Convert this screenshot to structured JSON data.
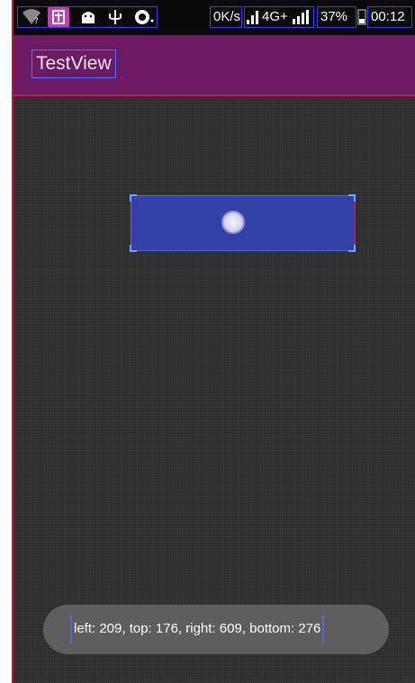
{
  "status_bar": {
    "icons": [
      "wifi-question-icon",
      "usb-debug-icon",
      "android-icon",
      "usb-icon",
      "chat-icon"
    ],
    "network_speed": "0K/s",
    "network_type": "4G+",
    "battery": "37%",
    "time": "00:12"
  },
  "app_bar": {
    "title": "TestView"
  },
  "test_view": {
    "label": ""
  },
  "toast": {
    "text": "left: 209, top: 176, right: 609, bottom: 276"
  },
  "colors": {
    "app_bar": "#6a1b64",
    "background": "#303030",
    "test_view": "#3340a8",
    "toast": "#5e5e5e"
  }
}
